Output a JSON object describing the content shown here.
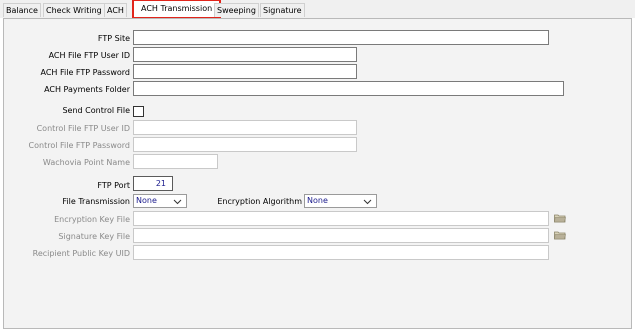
{
  "tabs": [
    {
      "label": "Balance"
    },
    {
      "label": "Check Writing"
    },
    {
      "label": "ACH"
    },
    {
      "label": "ACH Transmission"
    },
    {
      "label": "Sweeping"
    },
    {
      "label": "Signature"
    }
  ],
  "form": {
    "ftp_site": {
      "label": "FTP Site",
      "value": ""
    },
    "ach_user": {
      "label": "ACH File FTP User ID",
      "value": ""
    },
    "ach_password": {
      "label": "ACH File FTP Password",
      "value": ""
    },
    "ach_folder": {
      "label": "ACH Payments Folder",
      "value": ""
    },
    "send_control": {
      "label": "Send Control File",
      "checked": false
    },
    "control_user": {
      "label": "Control File FTP User ID",
      "value": ""
    },
    "control_password": {
      "label": "Control File FTP Password",
      "value": ""
    },
    "wachovia": {
      "label": "Wachovia Point Name",
      "value": ""
    },
    "ftp_port": {
      "label": "FTP Port",
      "value": "21"
    },
    "file_transmission": {
      "label": "File Transmission",
      "value": "None"
    },
    "encryption_algorithm": {
      "label": "Encryption Algorithm",
      "value": "None"
    },
    "encryption_key": {
      "label": "Encryption Key File",
      "value": ""
    },
    "signature_key": {
      "label": "Signature Key File",
      "value": ""
    },
    "recipient_key": {
      "label": "Recipient Public Key UID",
      "value": ""
    }
  },
  "icons": {
    "browse": "folder-icon",
    "dropdown": "chevron-down-icon"
  }
}
